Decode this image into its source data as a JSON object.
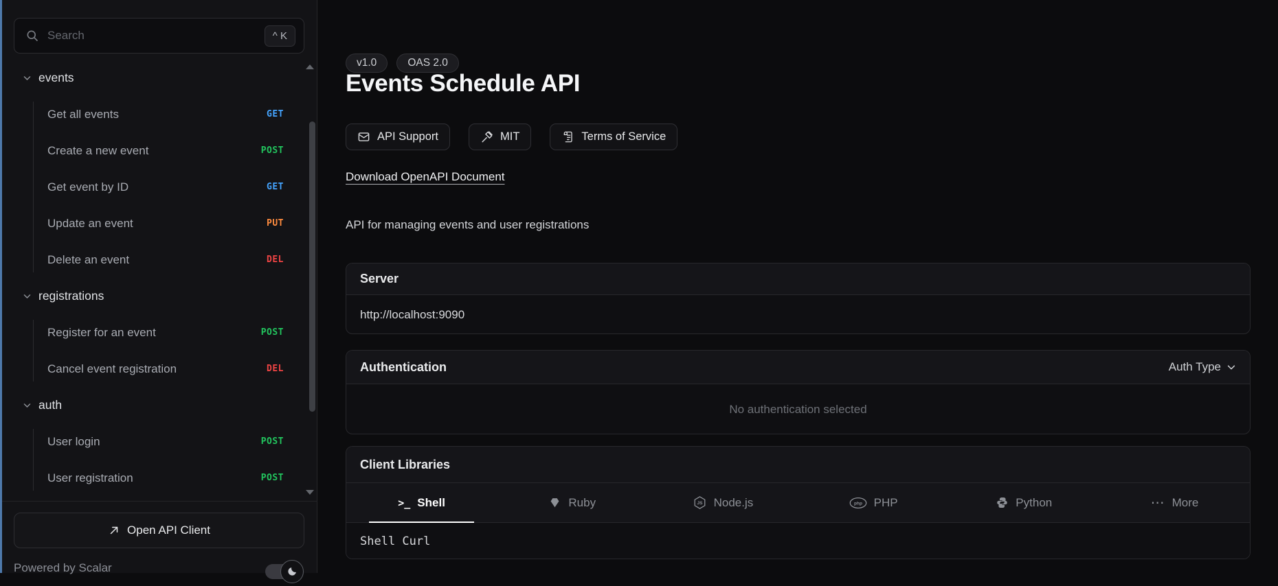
{
  "method_colors": {
    "GET": "#45a4ff",
    "POST": "#22c55e",
    "PUT": "#ff8c3f",
    "DEL": "#ef4444"
  },
  "sidebar": {
    "search": {
      "placeholder": "Search",
      "shortcut": "^ K",
      "icon": "search-icon"
    },
    "sections": [
      {
        "label": "events",
        "items": [
          {
            "label": "Get all events",
            "method": "GET"
          },
          {
            "label": "Create a new event",
            "method": "POST"
          },
          {
            "label": "Get event by ID",
            "method": "GET"
          },
          {
            "label": "Update an event",
            "method": "PUT"
          },
          {
            "label": "Delete an event",
            "method": "DEL"
          }
        ]
      },
      {
        "label": "registrations",
        "items": [
          {
            "label": "Register for an event",
            "method": "POST"
          },
          {
            "label": "Cancel event registration",
            "method": "DEL"
          }
        ]
      },
      {
        "label": "auth",
        "items": [
          {
            "label": "User login",
            "method": "POST"
          },
          {
            "label": "User registration",
            "method": "POST"
          }
        ]
      }
    ],
    "open_api_client_label": "Open API Client",
    "powered_by": "Powered by Scalar",
    "theme_toggle_icon": "moon-icon"
  },
  "header": {
    "badges": [
      "v1.0",
      "OAS 2.0"
    ],
    "title": "Events Schedule API",
    "links": [
      {
        "label": "API Support",
        "icon": "mail-icon",
        "name": "api-support-button"
      },
      {
        "label": "MIT",
        "icon": "license-icon",
        "name": "license-button"
      },
      {
        "label": "Terms of Service",
        "icon": "terms-icon",
        "name": "terms-of-service-button"
      }
    ],
    "download_label": "Download OpenAPI Document",
    "description": "API for managing events and user registrations"
  },
  "server": {
    "heading": "Server",
    "url": "http://localhost:9090"
  },
  "authentication": {
    "heading": "Authentication",
    "dropdown_label": "Auth Type",
    "empty_text": "No authentication selected"
  },
  "client_libraries": {
    "heading": "Client Libraries",
    "tabs": [
      {
        "label": "Shell",
        "icon": "shell-icon",
        "active": true
      },
      {
        "label": "Ruby",
        "icon": "ruby-icon",
        "active": false
      },
      {
        "label": "Node.js",
        "icon": "nodejs-icon",
        "active": false
      },
      {
        "label": "PHP",
        "icon": "php-icon",
        "active": false
      },
      {
        "label": "Python",
        "icon": "python-icon",
        "active": false
      },
      {
        "label": "More",
        "icon": "more-icon",
        "active": false
      }
    ],
    "selected_example": "Shell Curl"
  }
}
